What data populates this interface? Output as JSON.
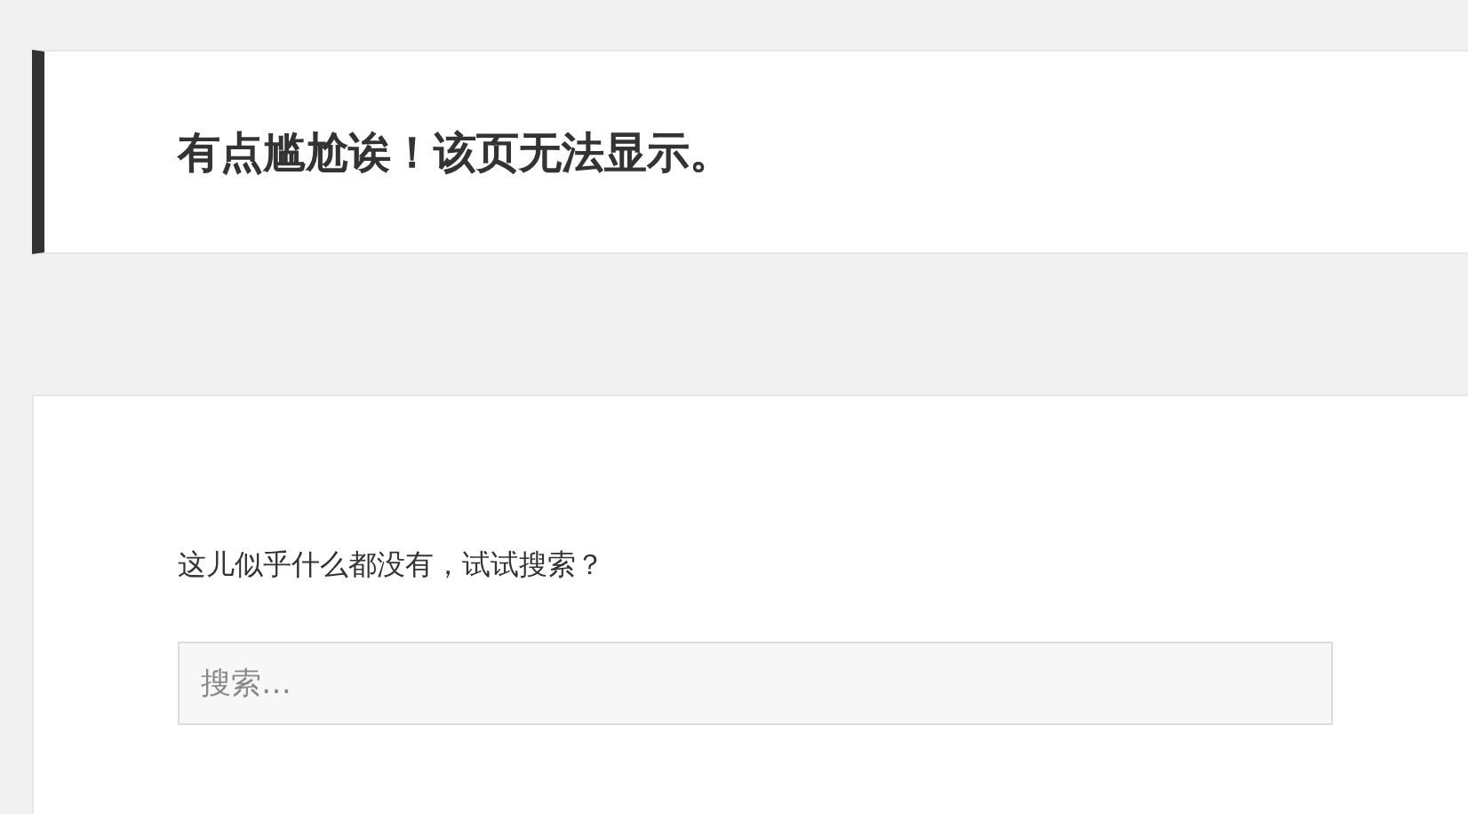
{
  "header": {
    "title": "有点尴尬诶！该页无法显示。"
  },
  "content": {
    "message": "这儿似乎什么都没有，试试搜索？",
    "search": {
      "placeholder": "搜索…"
    }
  }
}
